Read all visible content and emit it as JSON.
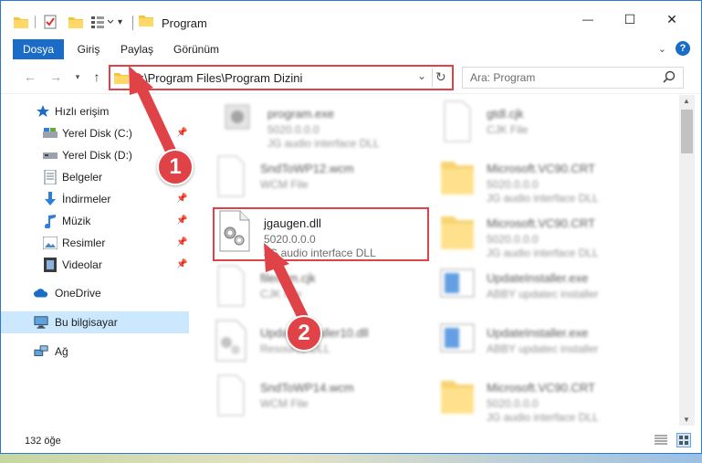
{
  "window": {
    "title": "Program",
    "minimize_glyph": "—",
    "maximize_glyph": "☐",
    "close_glyph": "✕"
  },
  "ribbon": {
    "tabs": [
      "Dosya",
      "Giriş",
      "Paylaş",
      "Görünüm"
    ]
  },
  "address_bar": {
    "path": "C:\\Program Files\\Program Dizini",
    "search_placeholder": "Ara: Program"
  },
  "sidebar": {
    "items": [
      {
        "label": "Hızlı erişim",
        "icon": "star-icon"
      },
      {
        "label": "Yerel Disk (C:)",
        "icon": "drive-icon"
      },
      {
        "label": "Yerel Disk (D:)",
        "icon": "drive-icon"
      },
      {
        "label": "Belgeler",
        "icon": "documents-icon"
      },
      {
        "label": "İndirmeler",
        "icon": "download-icon"
      },
      {
        "label": "Müzik",
        "icon": "music-icon"
      },
      {
        "label": "Resimler",
        "icon": "pictures-icon"
      },
      {
        "label": "Videolar",
        "icon": "video-icon"
      },
      {
        "label": "OneDrive",
        "icon": "cloud-icon"
      },
      {
        "label": "Bu bilgisayar",
        "icon": "computer-icon"
      },
      {
        "label": "Ağ",
        "icon": "network-icon"
      }
    ]
  },
  "files": [
    {
      "name": "program.exe",
      "line1": "5020.0.0.0",
      "line2": "JG audio interface DLL",
      "kind": "exe"
    },
    {
      "name": "gtdl.cjk",
      "line1": "CJK File",
      "line2": "",
      "kind": "doc"
    },
    {
      "name": "SndToWP12.wcm",
      "line1": "WCM File",
      "line2": "",
      "kind": "doc"
    },
    {
      "name": "Microsoft.VC90.CRT",
      "line1": "5020.0.0.0",
      "line2": "JG audio interface DLL",
      "kind": "folder"
    },
    {
      "name": "jgaugen.dll",
      "line1": "5020.0.0.0",
      "line2": "JG audio interface DLL",
      "kind": "dll"
    },
    {
      "name": "Microsoft.VC90.CRT",
      "line1": "5020.0.0.0",
      "line2": "JG audio interface DLL",
      "kind": "folder"
    },
    {
      "name": "filecam.cjk",
      "line1": "CJK File",
      "line2": "",
      "kind": "doc"
    },
    {
      "name": "UpdateInstaller.exe",
      "line1": "ABBY updatec installer",
      "line2": "",
      "kind": "installer"
    },
    {
      "name": "UpdateInstaller10.dll",
      "line1": "Resource DLL",
      "line2": "",
      "kind": "dll"
    },
    {
      "name": "UpdateInstaller.exe",
      "line1": "ABBY updatec installer",
      "line2": "",
      "kind": "installer"
    },
    {
      "name": "SndToWP14.wcm",
      "line1": "WCM File",
      "line2": "",
      "kind": "doc"
    },
    {
      "name": "Microsoft.VC90.CRT",
      "line1": "5020.0.0.0",
      "line2": "JG audio interface DLL",
      "kind": "folder"
    }
  ],
  "status": {
    "item_count": "132 öğe"
  },
  "callouts": [
    "1",
    "2"
  ],
  "colors": {
    "accent": "#1a6cc6",
    "highlight": "#e04347",
    "selection": "#cce8ff"
  }
}
